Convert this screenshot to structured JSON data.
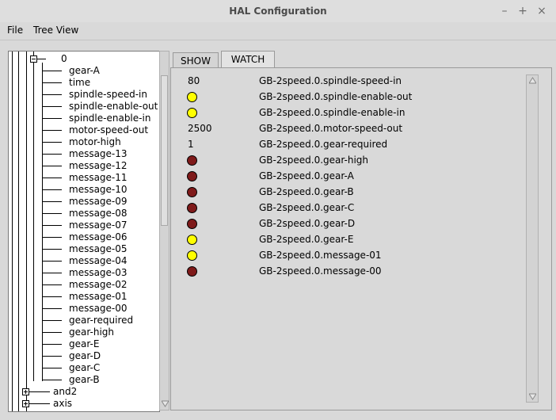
{
  "window": {
    "title": "HAL Configuration",
    "minimize": "–",
    "maximize": "+",
    "close": "×"
  },
  "menu": [
    "File",
    "Tree View"
  ],
  "tree": {
    "root_node": "0",
    "items": [
      "gear-A",
      "time",
      "spindle-speed-in",
      "spindle-enable-out",
      "spindle-enable-in",
      "motor-speed-out",
      "motor-high",
      "message-13",
      "message-12",
      "message-11",
      "message-10",
      "message-09",
      "message-08",
      "message-07",
      "message-06",
      "message-05",
      "message-04",
      "message-03",
      "message-02",
      "message-01",
      "message-00",
      "gear-required",
      "gear-high",
      "gear-E",
      "gear-D",
      "gear-C",
      "gear-B"
    ],
    "siblings": [
      "and2",
      "axis"
    ]
  },
  "tabs": [
    "SHOW",
    "WATCH"
  ],
  "active_tab": "WATCH",
  "colors": {
    "led_on": "#ffff00",
    "led_off": "#7f1a1a"
  },
  "watch": [
    {
      "kind": "value",
      "value": "80",
      "pin": "GB-2speed.0.spindle-speed-in"
    },
    {
      "kind": "led",
      "state": "on",
      "pin": "GB-2speed.0.spindle-enable-out"
    },
    {
      "kind": "led",
      "state": "on",
      "pin": "GB-2speed.0.spindle-enable-in"
    },
    {
      "kind": "value",
      "value": "2500",
      "pin": "GB-2speed.0.motor-speed-out"
    },
    {
      "kind": "value",
      "value": "1",
      "pin": "GB-2speed.0.gear-required"
    },
    {
      "kind": "led",
      "state": "off",
      "pin": "GB-2speed.0.gear-high"
    },
    {
      "kind": "led",
      "state": "off",
      "pin": "GB-2speed.0.gear-A"
    },
    {
      "kind": "led",
      "state": "off",
      "pin": "GB-2speed.0.gear-B"
    },
    {
      "kind": "led",
      "state": "off",
      "pin": "GB-2speed.0.gear-C"
    },
    {
      "kind": "led",
      "state": "off",
      "pin": "GB-2speed.0.gear-D"
    },
    {
      "kind": "led",
      "state": "on",
      "pin": "GB-2speed.0.gear-E"
    },
    {
      "kind": "led",
      "state": "on",
      "pin": "GB-2speed.0.message-01"
    },
    {
      "kind": "led",
      "state": "off",
      "pin": "GB-2speed.0.message-00"
    }
  ]
}
